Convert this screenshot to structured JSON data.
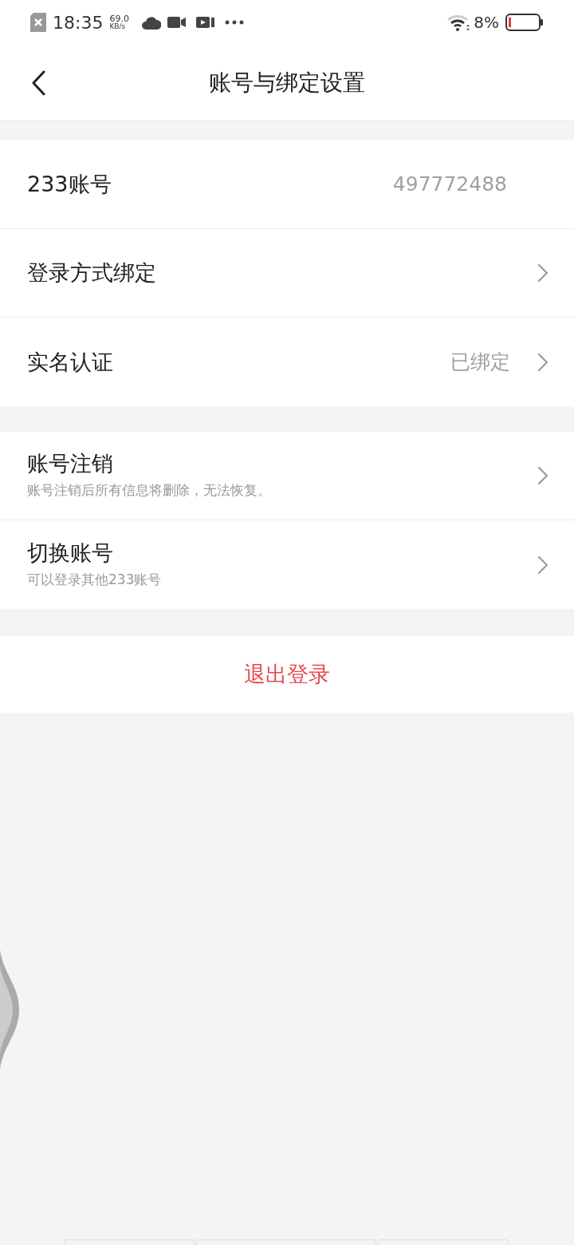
{
  "status_bar": {
    "time": "18:35",
    "speed": "69.0",
    "speed_unit": "KB/s",
    "battery": "8%"
  },
  "header": {
    "title": "账号与绑定设置"
  },
  "sections": [
    {
      "rows": [
        {
          "kind": "info",
          "label": "233账号",
          "value": "497772488"
        },
        {
          "kind": "link",
          "label": "登录方式绑定"
        },
        {
          "kind": "link",
          "label": "实名认证",
          "value": "已绑定"
        }
      ]
    },
    {
      "rows": [
        {
          "kind": "link",
          "label": "账号注销",
          "subtitle": "账号注销后所有信息将删除，无法恢复。"
        },
        {
          "kind": "link",
          "label": "切换账号",
          "subtitle": "可以登录其他233账号"
        }
      ]
    }
  ],
  "logout": {
    "label": "退出登录"
  }
}
